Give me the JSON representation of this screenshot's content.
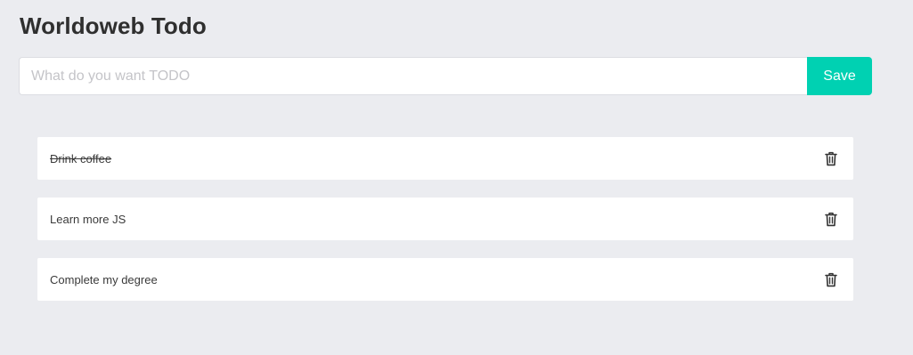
{
  "app": {
    "title": "Worldoweb Todo"
  },
  "form": {
    "placeholder": "What do you want TODO",
    "value": "",
    "save_label": "Save"
  },
  "todos": [
    {
      "text": "Drink coffee",
      "completed": true
    },
    {
      "text": "Learn more JS",
      "completed": false
    },
    {
      "text": "Complete my degree",
      "completed": false
    }
  ],
  "icons": {
    "delete": "trash-icon"
  },
  "colors": {
    "background": "#ebecf0",
    "accent": "#00d1b2",
    "card": "#ffffff"
  }
}
